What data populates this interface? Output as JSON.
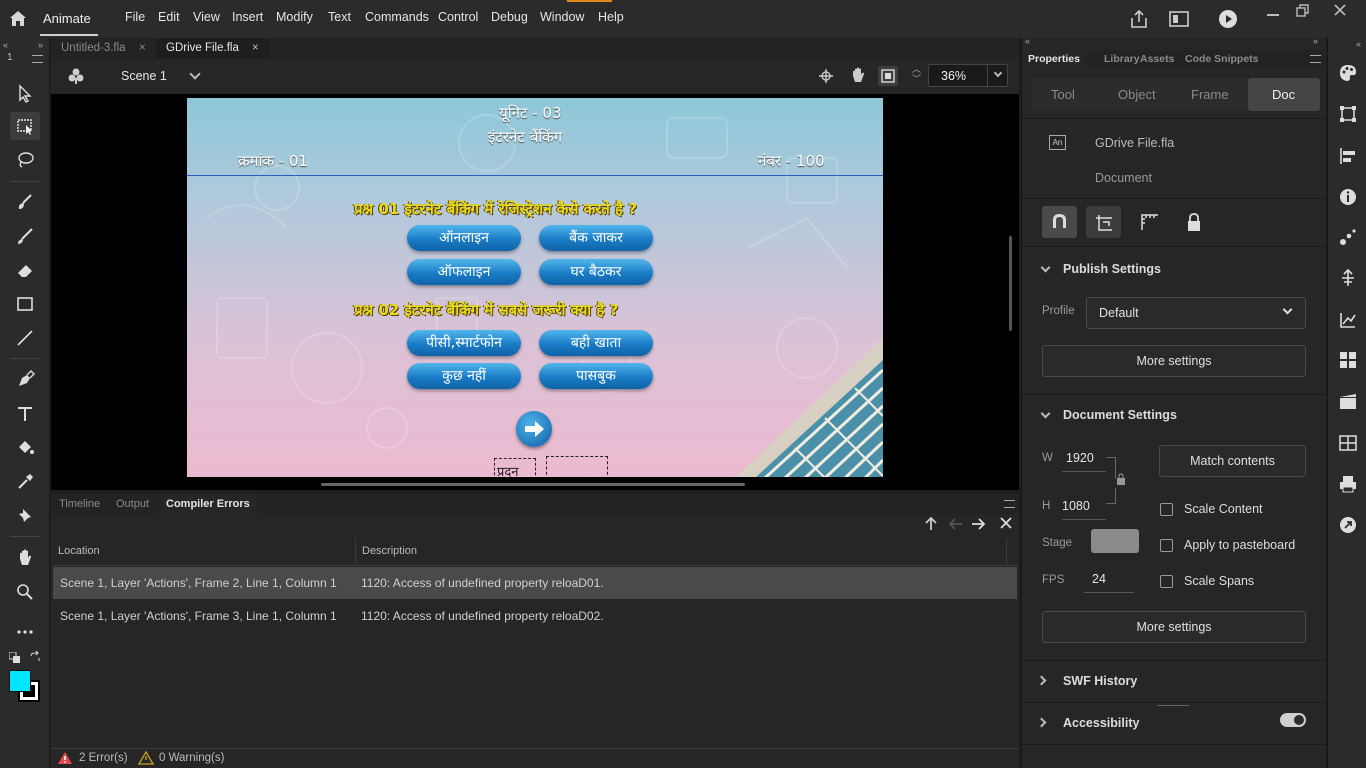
{
  "app": {
    "name": "Animate"
  },
  "menu": [
    "File",
    "Edit",
    "View",
    "Insert",
    "Modify",
    "Text",
    "Commands",
    "Control",
    "Debug",
    "Window",
    "Help"
  ],
  "left_toolbar": {
    "counter": "1"
  },
  "document_tabs": [
    {
      "label": "Untitled-3.fla",
      "active": false
    },
    {
      "label": "GDrive File.fla",
      "active": true
    }
  ],
  "scene_bar": {
    "scene": "Scene 1",
    "zoom": "36%"
  },
  "stage": {
    "title": "यूनिट - 03",
    "subtitle": "इंटरनेट बैंकिंग",
    "serial": "क्रमांक - 01",
    "marks": "नंबर - 100",
    "question1": "प्रश्न 01  इंटरनेट बैंकिंग में रेजिस्ट्रेशन कैसे करते है ?",
    "q1_options": [
      "ऑनलाइन",
      "बैंक जाकर",
      "ऑफलाइन",
      "घर बैठकर"
    ],
    "question2": "प्रश्न 02  इंटरनेट बैंकिंग में सबसे जरूरी क्या है ?",
    "q2_options": [
      "पीसी,स्मार्टफोन",
      "बही खाता",
      "कुछ नहीं",
      "पासबुक"
    ],
    "partial_text": "प्रदन"
  },
  "bottom_panel": {
    "tabs": [
      "Timeline",
      "Output",
      "Compiler Errors"
    ],
    "active_tab": "Compiler Errors",
    "columns": [
      "Location",
      "Description"
    ],
    "rows": [
      {
        "location": "Scene 1, Layer 'Actions', Frame 2, Line 1, Column 1",
        "description": "1120: Access of undefined property reloaD01.",
        "selected": true
      },
      {
        "location": "Scene 1, Layer 'Actions', Frame 3, Line 1, Column 1",
        "description": "1120: Access of undefined property reloaD02.",
        "selected": false
      }
    ],
    "status": {
      "errors": "2 Error(s)",
      "warnings": "0 Warning(s)"
    }
  },
  "properties": {
    "tabs": [
      "Properties",
      "Library",
      "Assets",
      "Code Snippets"
    ],
    "subtabs": [
      "Tool",
      "Object",
      "Frame",
      "Doc"
    ],
    "active_subtab": "Doc",
    "doc_badge": "An",
    "file_name": "GDrive File.fla",
    "doc_type": "Document",
    "publish": {
      "title": "Publish Settings",
      "profile_label": "Profile",
      "profile_value": "Default",
      "more": "More settings"
    },
    "document": {
      "title": "Document Settings",
      "w_label": "W",
      "w_value": "1920",
      "h_label": "H",
      "h_value": "1080",
      "match": "Match contents",
      "scale_content": "Scale Content",
      "stage_label": "Stage",
      "stage_color": "#8a8a8a",
      "apply_pasteboard": "Apply to pasteboard",
      "fps_label": "FPS",
      "fps_value": "24",
      "scale_spans": "Scale Spans",
      "more": "More settings"
    },
    "swf_history": "SWF History",
    "accessibility": "Accessibility"
  },
  "colors": {
    "fill": "#00e5ff",
    "stroke": "#000000",
    "error": "#e34850",
    "warning": "#c9a227",
    "selected_row": "#4a4a4a"
  }
}
